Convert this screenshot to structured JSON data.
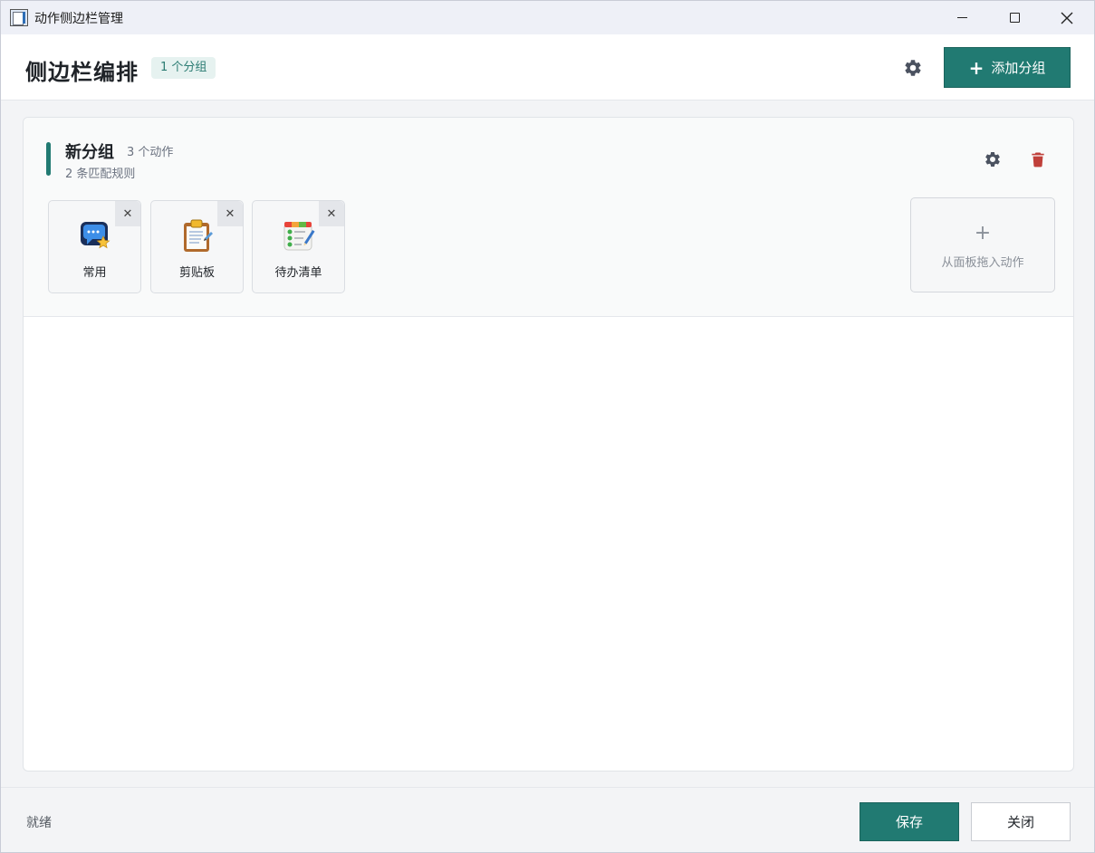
{
  "window": {
    "title": "动作侧边栏管理"
  },
  "header": {
    "title": "侧边栏编排",
    "group_badge": "1 个分组",
    "settings_icon": "gear-icon",
    "add_group_label": "添加分组",
    "add_group_icon": "plus-icon"
  },
  "group": {
    "name": "新分组",
    "action_count": "3 个动作",
    "rules": "2 条匹配规则",
    "settings_icon": "gear-icon",
    "delete_icon": "trash-icon",
    "actions": [
      {
        "label": "常用",
        "icon": "chat-star-icon"
      },
      {
        "label": "剪贴板",
        "icon": "clipboard-icon"
      },
      {
        "label": "待办清单",
        "icon": "todo-list-icon"
      }
    ],
    "drop_zone": {
      "label": "从面板拖入动作"
    }
  },
  "footer": {
    "status": "就绪",
    "save_label": "保存",
    "close_label": "关闭"
  },
  "colors": {
    "accent": "#217a72",
    "danger": "#c0403a"
  }
}
